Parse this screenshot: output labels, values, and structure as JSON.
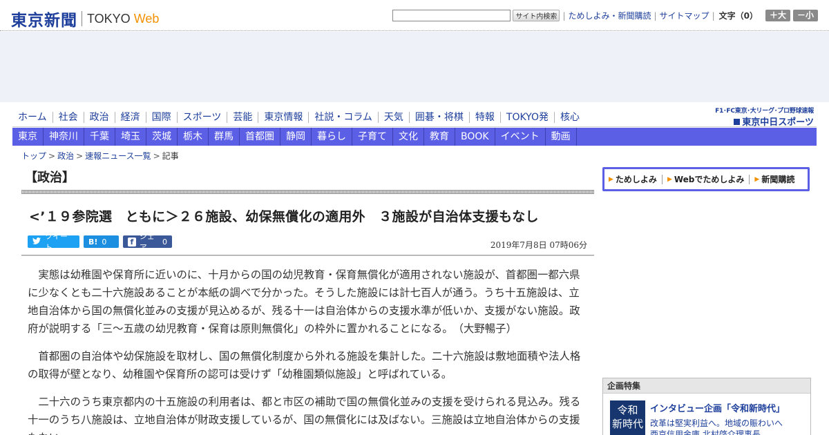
{
  "header": {
    "logo_jp": "東京新聞",
    "logo_en": "TOKYO",
    "logo_web": "Web",
    "search_placeholder": "",
    "search_button": "サイト内検索",
    "links": [
      "ためしよみ・新聞購読",
      "サイトマップ"
    ],
    "font_size_label": "文字（0）",
    "font_bigger": "＋大",
    "font_smaller": "－小"
  },
  "nav_primary": [
    "ホーム",
    "社会",
    "政治",
    "経済",
    "国際",
    "スポーツ",
    "芸能",
    "東京情報",
    "社説・コラム",
    "天気",
    "囲碁・将棋",
    "特報",
    "TOKYO発",
    "核心"
  ],
  "nav_regional": [
    "東京",
    "神奈川",
    "千葉",
    "埼玉",
    "茨城",
    "栃木",
    "群馬",
    "首都圏",
    "静岡",
    "暮らし",
    "子育て",
    "文化",
    "教育",
    "BOOK",
    "イベント",
    "動画"
  ],
  "chunichi": {
    "tagline": "F1･FC東京･大リーグ･プロ野球速報",
    "brand_prefix": "東京",
    "brand_name": "中日スポーツ"
  },
  "breadcrumb": {
    "items": [
      "トップ",
      "政治",
      "速報ニュース一覧"
    ],
    "current": "記事",
    "separator": ">"
  },
  "article": {
    "section": "【政治】",
    "headline": "<’１９参院選　ともに＞２６施設、幼保無償化の適用外　３施設が自治体支援もなし",
    "date": "2019年7月8日 07時06分",
    "social": {
      "tweet_label": "ツイート",
      "hatena_label": "B!",
      "hatena_count": "0",
      "share_label": "シェア",
      "share_count": "0"
    },
    "paragraphs": [
      "実態は幼稚園や保育所に近いのに、十月からの国の幼児教育・保育無償化が適用されない施設が、首都圏一都六県に少なくとも二十六施設あることが本紙の調べで分かった。そうした施設には計七百人が通う。うち十五施設は、立地自治体から国の無償化並みの支援が見込めるが、残る十一は自治体からの支援水準が低いか、支援がない施設。政府が説明する「三～五歳の幼児教育・保育は原則無償化」の枠外に置かれることになる。　（大野暢子）",
      "首都圏の自治体や幼保施設を取材し、国の無償化制度から外れる施設を集計した。二十六施設は敷地面積や法人格の取得が壁となり、幼稚園や保育所の認可は受けず「幼稚園類似施設」と呼ばれている。",
      "二十六のうち東京都内の十五施設の利用者は、都と市区の補助で国の無償化並みの支援を受けられる見込み。残る十一のうち八施設は、立地自治体が財政支援しているが、国の無償化には及ばない。三施設は立地自治体からの支援もない。"
    ]
  },
  "subscribe_bar": {
    "items": [
      "ためしよみ",
      "Webでためしよみ",
      "新聞購読"
    ]
  },
  "feature": {
    "heading": "企画特集",
    "thumb_line1": "令和",
    "thumb_line2": "新時代",
    "title": "インタビュー企画「令和新時代」",
    "desc_line1": "改革は堅実利益へ。地域の賑わいへ",
    "desc_line2": "西京信用金庫 北村啓介理事長"
  },
  "colors": {
    "brand_blue": "#1d3f9b",
    "nav_purple": "#5b5fe6",
    "accent_orange": "#f29100"
  }
}
